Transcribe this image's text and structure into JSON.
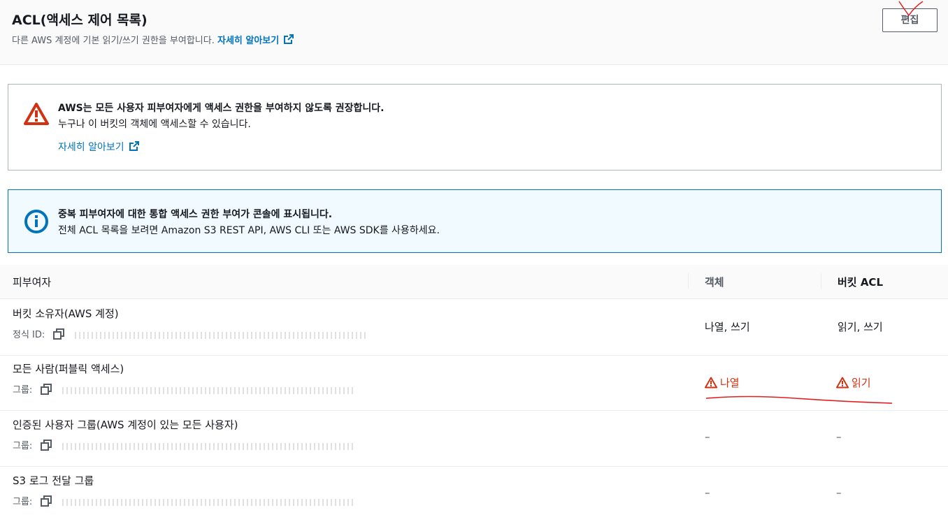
{
  "header": {
    "title": "ACL(액세스 제어 목록)",
    "description": "다른 AWS 계정에 기본 읽기/쓰기 권한을 부여합니다.",
    "learn_more": "자세히 알아보기",
    "edit_button": "편집"
  },
  "warning": {
    "title": "AWS는 모든 사용자 피부여자에게 액세스 권한을 부여하지 않도록 권장합니다.",
    "text": "누구나 이 버킷의 객체에 액세스할 수 있습니다.",
    "link": "자세히 알아보기"
  },
  "info": {
    "title": "중복 피부여자에 대한 통합 액세스 권한 부여가 콘솔에 표시됩니다.",
    "text": "전체 ACL 목록을 보려면 Amazon S3 REST API, AWS CLI 또는 AWS SDK를 사용하세요."
  },
  "table": {
    "columns": [
      "피부여자",
      "객체",
      "버킷 ACL"
    ],
    "rows": [
      {
        "name": "버킷 소유자(AWS 계정)",
        "id_label": "정식 ID:",
        "objects": "나열, 쓰기",
        "bucket_acl": "읽기, 쓰기",
        "warn": false
      },
      {
        "name": "모든 사람(퍼블릭 액세스)",
        "id_label": "그룹:",
        "objects": "나열",
        "bucket_acl": "읽기",
        "warn": true
      },
      {
        "name": "인증된 사용자 그룹(AWS 계정이 있는 모든 사용자)",
        "id_label": "그룹:",
        "objects": "–",
        "bucket_acl": "–",
        "warn": false
      },
      {
        "name": "S3 로그 전달 그룹",
        "id_label": "그룹:",
        "objects": "–",
        "bucket_acl": "–",
        "warn": false
      }
    ]
  },
  "icons": {
    "warning": "warning-triangle-icon",
    "info": "info-circle-icon",
    "external": "external-link-icon",
    "copy": "copy-icon"
  },
  "colors": {
    "link": "#0073bb",
    "warning": "#d13212",
    "info_bg": "#f1faff",
    "annotation": "#e02020"
  }
}
